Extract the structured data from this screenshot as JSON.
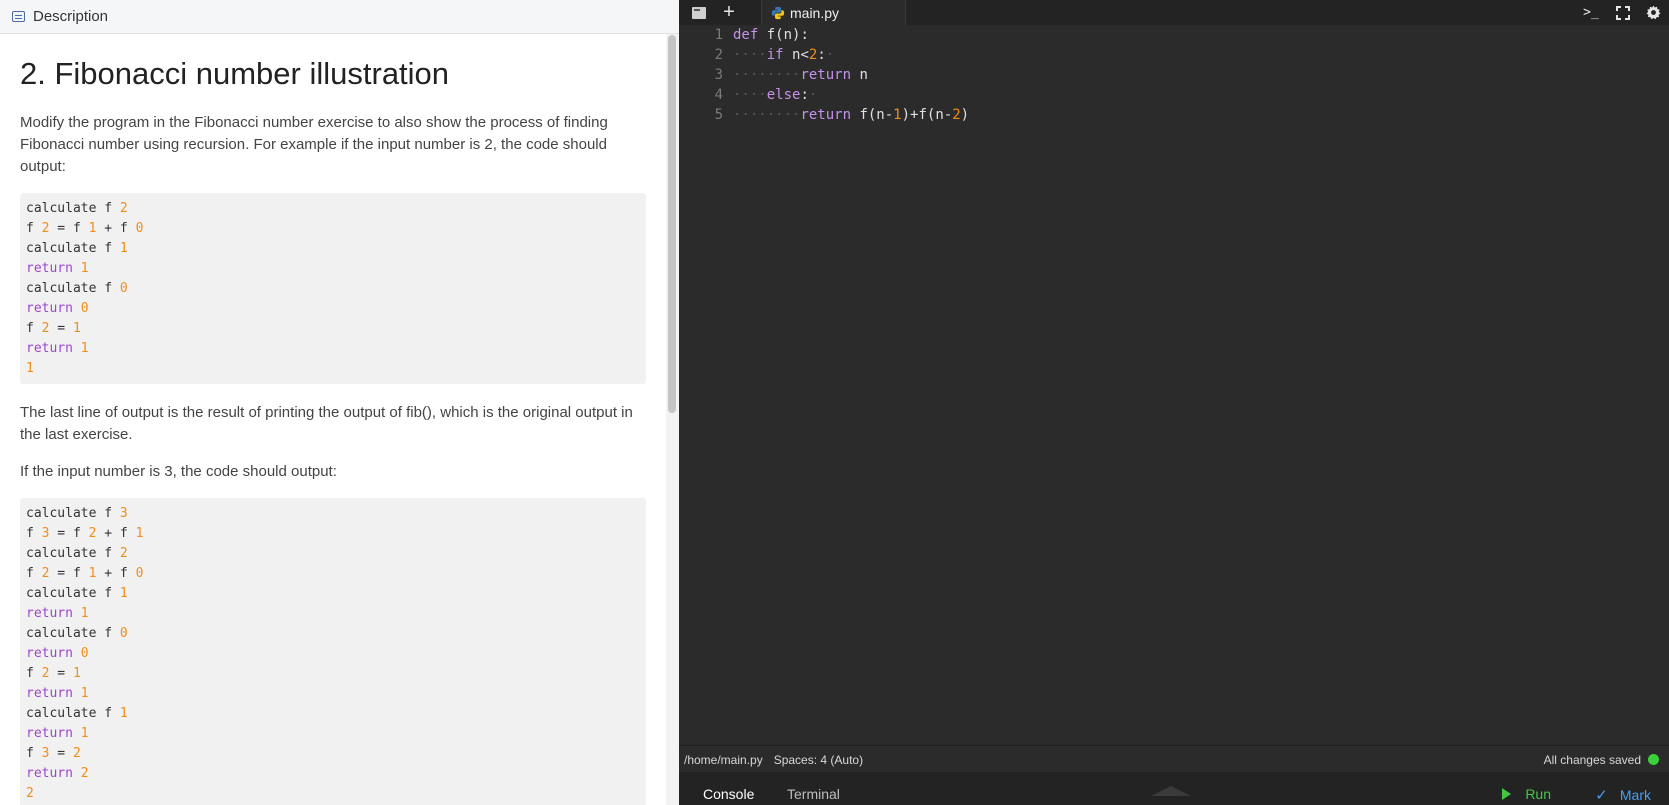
{
  "description": {
    "header_label": "Description",
    "title": "2. Fibonacci number illustration",
    "intro": "Modify the program in the Fibonacci number exercise to also show the process of finding Fibonacci number using recursion. For example if the input number is 2, the code should output:",
    "example1": [
      [
        [
          "t",
          "calculate f "
        ],
        [
          "n",
          "2"
        ]
      ],
      [
        [
          "t",
          "f "
        ],
        [
          "n",
          "2"
        ],
        [
          "t",
          " = f "
        ],
        [
          "n",
          "1"
        ],
        [
          "t",
          " + f "
        ],
        [
          "n",
          "0"
        ]
      ],
      [
        [
          "t",
          "calculate f "
        ],
        [
          "n",
          "1"
        ]
      ],
      [
        [
          "k",
          "return "
        ],
        [
          "n",
          "1"
        ]
      ],
      [
        [
          "t",
          "calculate f "
        ],
        [
          "n",
          "0"
        ]
      ],
      [
        [
          "k",
          "return "
        ],
        [
          "n",
          "0"
        ]
      ],
      [
        [
          "t",
          "f "
        ],
        [
          "n",
          "2"
        ],
        [
          "t",
          " = "
        ],
        [
          "n",
          "1"
        ]
      ],
      [
        [
          "k",
          "return "
        ],
        [
          "n",
          "1"
        ]
      ],
      [
        [
          "n",
          "1"
        ]
      ]
    ],
    "middle": "The last line of output is the result of printing the output of fib(), which is the original output in the last exercise.",
    "second_intro": "If the input number is 3, the code should output:",
    "example2": [
      [
        [
          "t",
          "calculate f "
        ],
        [
          "n",
          "3"
        ]
      ],
      [
        [
          "t",
          "f "
        ],
        [
          "n",
          "3"
        ],
        [
          "t",
          " = f "
        ],
        [
          "n",
          "2"
        ],
        [
          "t",
          " + f "
        ],
        [
          "n",
          "1"
        ]
      ],
      [
        [
          "t",
          "calculate f "
        ],
        [
          "n",
          "2"
        ]
      ],
      [
        [
          "t",
          "f "
        ],
        [
          "n",
          "2"
        ],
        [
          "t",
          " = f "
        ],
        [
          "n",
          "1"
        ],
        [
          "t",
          " + f "
        ],
        [
          "n",
          "0"
        ]
      ],
      [
        [
          "t",
          "calculate f "
        ],
        [
          "n",
          "1"
        ]
      ],
      [
        [
          "k",
          "return "
        ],
        [
          "n",
          "1"
        ]
      ],
      [
        [
          "t",
          "calculate f "
        ],
        [
          "n",
          "0"
        ]
      ],
      [
        [
          "k",
          "return "
        ],
        [
          "n",
          "0"
        ]
      ],
      [
        [
          "t",
          "f "
        ],
        [
          "n",
          "2"
        ],
        [
          "t",
          " = "
        ],
        [
          "n",
          "1"
        ]
      ],
      [
        [
          "k",
          "return "
        ],
        [
          "n",
          "1"
        ]
      ],
      [
        [
          "t",
          "calculate f "
        ],
        [
          "n",
          "1"
        ]
      ],
      [
        [
          "k",
          "return "
        ],
        [
          "n",
          "1"
        ]
      ],
      [
        [
          "t",
          "f "
        ],
        [
          "n",
          "3"
        ],
        [
          "t",
          " = "
        ],
        [
          "n",
          "2"
        ]
      ],
      [
        [
          "k",
          "return "
        ],
        [
          "n",
          "2"
        ]
      ],
      [
        [
          "n",
          "2"
        ]
      ]
    ]
  },
  "editor": {
    "file_tab": "main.py",
    "lines": [
      {
        "num": "1",
        "tokens": [
          [
            "k",
            "def"
          ],
          [
            "t",
            " f(n):"
          ]
        ]
      },
      {
        "num": "2",
        "tokens": [
          [
            "w",
            "····"
          ],
          [
            "k",
            "if"
          ],
          [
            "t",
            " n"
          ],
          [
            "o",
            "<"
          ],
          [
            "n",
            "2"
          ],
          [
            "t",
            ":"
          ],
          [
            "w",
            "·"
          ]
        ]
      },
      {
        "num": "3",
        "tokens": [
          [
            "w",
            "········"
          ],
          [
            "k",
            "return"
          ],
          [
            "t",
            " n"
          ]
        ]
      },
      {
        "num": "4",
        "tokens": [
          [
            "w",
            "····"
          ],
          [
            "k",
            "else"
          ],
          [
            "t",
            ":"
          ],
          [
            "w",
            "·"
          ]
        ]
      },
      {
        "num": "5",
        "tokens": [
          [
            "w",
            "········"
          ],
          [
            "k",
            "return"
          ],
          [
            "t",
            " f(n"
          ],
          [
            "o",
            "-"
          ],
          [
            "n",
            "1"
          ],
          [
            "t",
            ")"
          ],
          [
            "o",
            "+"
          ],
          [
            "t",
            "f(n"
          ],
          [
            "o",
            "-"
          ],
          [
            "n",
            "2"
          ],
          [
            "t",
            ")"
          ]
        ]
      }
    ]
  },
  "status": {
    "path": "/home/main.py",
    "spaces": "Spaces: 4 (Auto)",
    "saved": "All changes saved",
    "saved_color": "#3bd13b"
  },
  "bottom": {
    "console_label": "Console",
    "terminal_label": "Terminal",
    "run_label": "Run",
    "mark_label": "Mark",
    "run_color": "#43c743",
    "mark_color": "#4a9df0"
  },
  "icons": {
    "files": "files-icon",
    "add": "plus-icon",
    "python": "python-icon",
    "terminal": "terminal-icon",
    "fullscreen": "fullscreen-icon",
    "settings": "gear-icon",
    "run": "play-icon",
    "mark": "check-icon",
    "collapse": "chevron-up-icon"
  }
}
